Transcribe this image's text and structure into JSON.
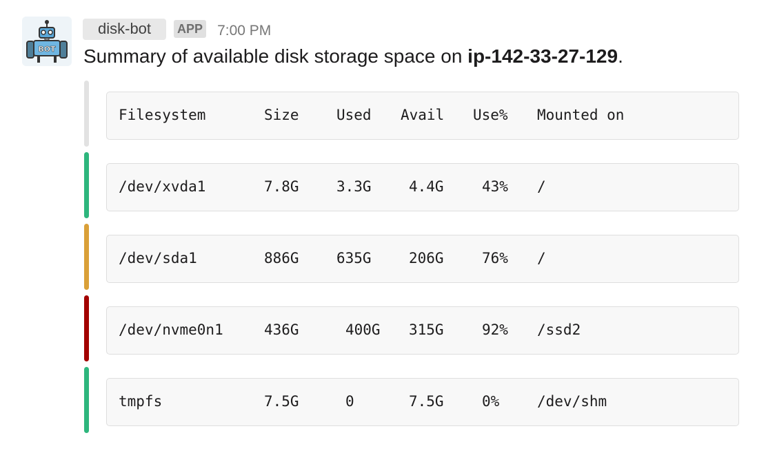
{
  "message": {
    "username": "disk-bot",
    "badge": "APP",
    "timestamp": "7:00 PM",
    "text_prefix": "Summary of available disk storage space on ",
    "hostname": "ip-142-33-27-129",
    "text_suffix": ".",
    "avatar_icon": "robot-icon",
    "avatar_label": "BOT"
  },
  "attachments": [
    {
      "color": "#e2e2e2",
      "cells": [
        "Filesystem",
        "Size",
        "Used",
        "Avail",
        "Use%",
        "Mounted on"
      ]
    },
    {
      "color": "#2eb67d",
      "cells": [
        "/dev/xvda1",
        "7.8G",
        "3.3G",
        "4.4G",
        "43%",
        "/"
      ]
    },
    {
      "color": "#daa038",
      "cells": [
        "/dev/sda1",
        "886G",
        "635G",
        "206G",
        "76%",
        "/"
      ]
    },
    {
      "color": "#a30200",
      "cells": [
        "/dev/nvme0n1",
        "436G",
        "400G",
        "315G",
        "92%",
        "/ssd2"
      ]
    },
    {
      "color": "#2eb67d",
      "cells": [
        "tmpfs",
        "7.5G",
        "0",
        "7.5G",
        "0%",
        "/dev/shm"
      ]
    }
  ]
}
